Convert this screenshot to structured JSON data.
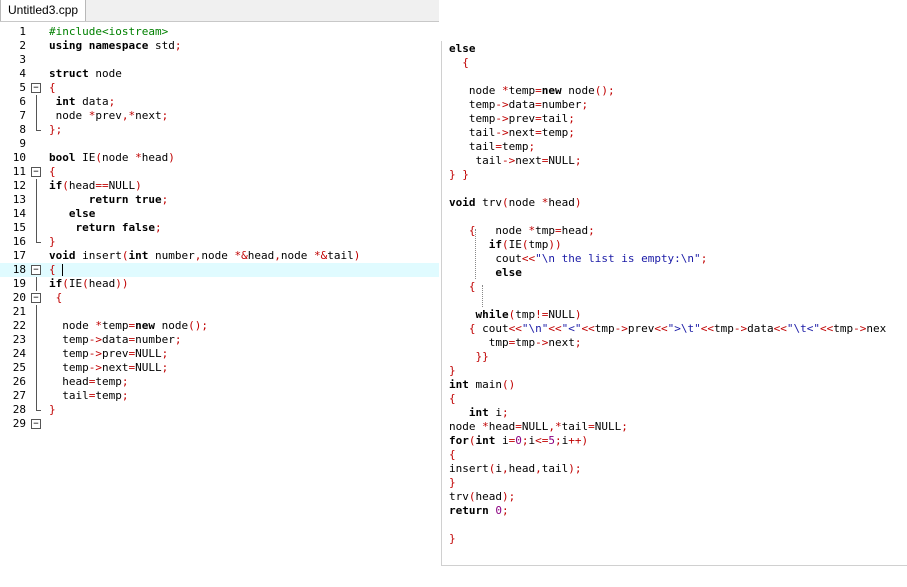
{
  "tab": {
    "title": "Untitled3.cpp"
  },
  "left": {
    "line_numbers": [
      "1",
      "2",
      "3",
      "4",
      "5",
      "6",
      "7",
      "8",
      "9",
      "10",
      "11",
      "12",
      "13",
      "14",
      "15",
      "16",
      "17",
      "18",
      "19",
      "20",
      "21",
      "22",
      "23",
      "24",
      "25",
      "26",
      "27",
      "28",
      "29"
    ],
    "lines": [
      "#include<iostream>",
      "using namespace std;",
      "",
      "struct node",
      "{",
      " int data;",
      " node *prev,*next;",
      "};",
      "",
      "bool IE(node *head)",
      "{",
      "if(head==NULL)",
      "      return true;",
      "   else",
      "    return false;",
      "}",
      "void insert(int number,node *&head,node *&tail)",
      "{ ",
      "if(IE(head))",
      " {",
      "",
      "  node *temp=new node();",
      "  temp->data=number;",
      "  temp->prev=NULL;",
      "  temp->next=NULL;",
      "  head=temp;",
      "  tail=temp;",
      "}",
      ""
    ]
  },
  "right": {
    "lines": [
      "else",
      "  {",
      "",
      "   node *temp=new node();",
      "   temp->data=number;",
      "   temp->prev=tail;",
      "   tail->next=temp;",
      "   tail=temp;",
      "    tail->next=NULL;",
      "} }",
      "",
      "void trv(node *head)",
      "",
      "   {   node *tmp=head;",
      "      if(IE(tmp))",
      "       cout<<\"\\n the list is empty:\\n\";",
      "       else",
      "   {",
      "",
      "    while(tmp!=NULL)",
      "   { cout<<\"\\n\"<<\"<\"<<tmp->prev<<\">\\t\"<<tmp->data<<\"\\t<\"<<tmp->nex",
      "      tmp=tmp->next;",
      "    }}",
      "}",
      "int main()",
      "{",
      "   int i;",
      "node *head=NULL,*tail=NULL;",
      "for(int i=0;i<=5;i++)",
      "{",
      "insert(i,head,tail);",
      "}",
      "trv(head);",
      "return 0;",
      "",
      "}"
    ]
  }
}
